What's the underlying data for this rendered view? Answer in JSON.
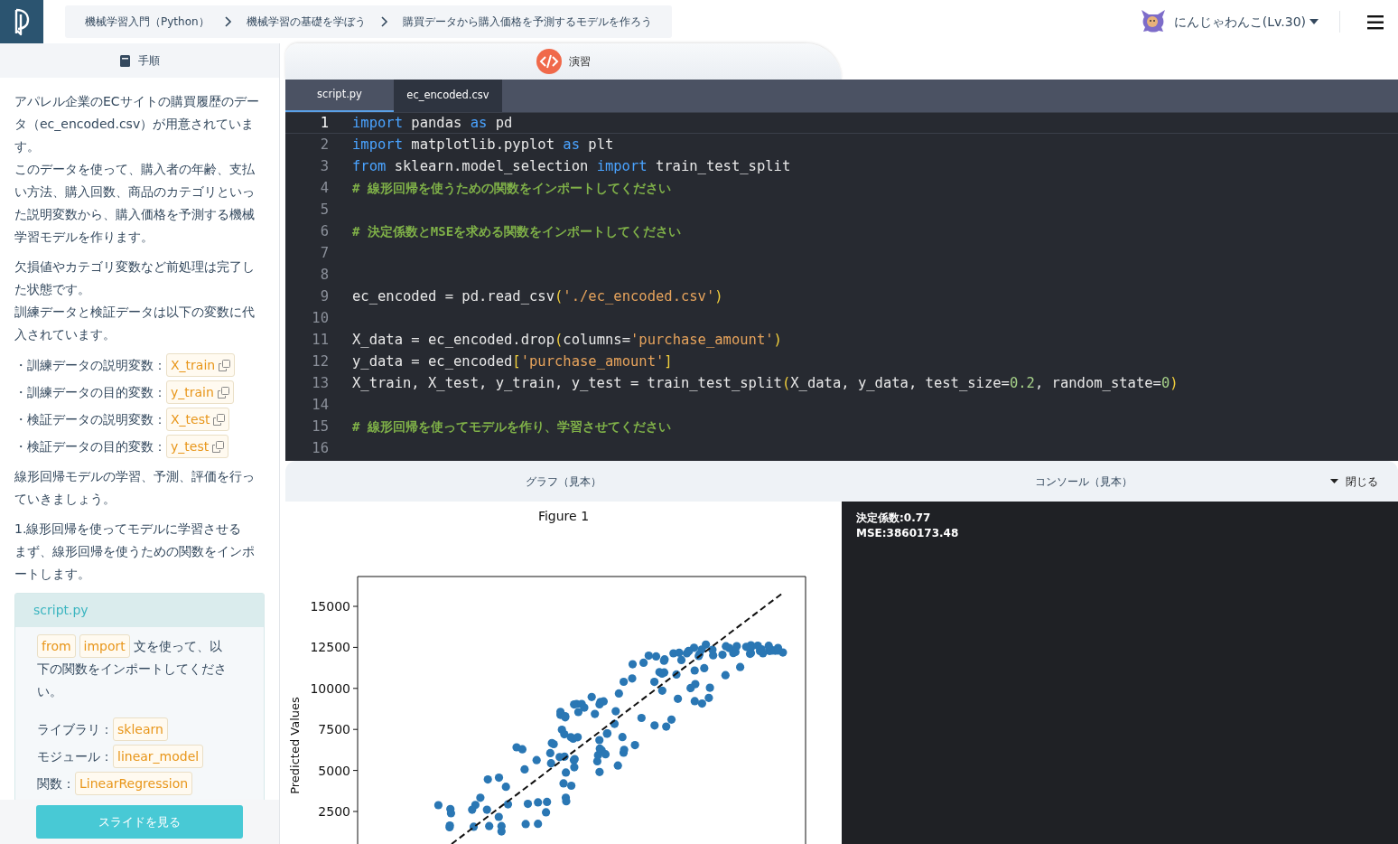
{
  "header": {
    "breadcrumb": [
      "機械学習入門（Python）",
      "機械学習の基礎を学ぼう",
      "購買データから購入価格を予測するモデルを作ろう"
    ],
    "user": "にんじゃわんこ(Lv.30)"
  },
  "steps_panel": {
    "tab": "手順",
    "paragraphs_before": [
      [
        "アパレル企業のECサイトの購買履歴のデータ（ec_encoded.csv）が用意されています。",
        "このデータを使って、購入者の年齢、支払い方法、購入回数、商品のカテゴリといった説明変数から、購入価格を予測する機械学習モデルを作ります。"
      ],
      [
        "欠損値やカテゴリ変数など前処理は完了した状態です。",
        "訓練データと検証データは以下の変数に代入されています。"
      ]
    ],
    "variables": [
      {
        "label": "・訓練データの説明変数：",
        "value": "X_train"
      },
      {
        "label": "・訓練データの目的変数：",
        "value": "y_train"
      },
      {
        "label": "・検証データの説明変数：",
        "value": "X_test"
      },
      {
        "label": "・検証データの目的変数：",
        "value": "y_test"
      }
    ],
    "paragraphs_after": [
      [
        "線形回帰モデルの学習、予測、評価を行っていきましょう。"
      ],
      [
        "1.線形回帰を使ってモデルに学習させる",
        "まず、線形回帰を使うための関数をインポートします。"
      ]
    ],
    "hint": {
      "title": "script.py",
      "chips": [
        "from",
        "import"
      ],
      "text": "文を使って、以下の関数をインポートしてください。",
      "items": [
        {
          "label": "ライブラリ：",
          "value": "sklearn"
        },
        {
          "label": "モジュール：",
          "value": "linear_model"
        },
        {
          "label": "関数：",
          "value": "LinearRegression"
        }
      ]
    },
    "button": "スライドを見る"
  },
  "exercise_tab": "演習",
  "files": [
    {
      "name": "script.py",
      "selected": true
    },
    {
      "name": "ec_encoded.csv",
      "selected": false
    }
  ],
  "code_lines": [
    {
      "number": "1",
      "current": true,
      "tokens": [
        {
          "kind": "keyword",
          "text": "import"
        },
        {
          "kind": "plain",
          "text": " pandas "
        },
        {
          "kind": "keyword",
          "text": "as"
        },
        {
          "kind": "plain",
          "text": " pd"
        }
      ]
    },
    {
      "number": "2",
      "current": false,
      "tokens": [
        {
          "kind": "keyword",
          "text": "import"
        },
        {
          "kind": "plain",
          "text": " matplotlib.pyplot "
        },
        {
          "kind": "keyword",
          "text": "as"
        },
        {
          "kind": "plain",
          "text": " plt"
        }
      ]
    },
    {
      "number": "3",
      "current": false,
      "tokens": [
        {
          "kind": "keyword",
          "text": "from"
        },
        {
          "kind": "plain",
          "text": " sklearn.model_selection "
        },
        {
          "kind": "keyword",
          "text": "import"
        },
        {
          "kind": "plain",
          "text": " train_test_split"
        }
      ]
    },
    {
      "number": "4",
      "current": false,
      "tokens": [
        {
          "kind": "comment",
          "text": "# 線形回帰を使うための関数をインポートしてください"
        }
      ]
    },
    {
      "number": "5",
      "current": false
    },
    {
      "number": "6",
      "current": false,
      "tokens": [
        {
          "kind": "comment",
          "text": "# 決定係数とMSEを求める関数をインポートしてください"
        }
      ]
    },
    {
      "number": "7",
      "current": false
    },
    {
      "number": "8",
      "current": false
    },
    {
      "number": "9",
      "current": false,
      "tokens": [
        {
          "kind": "plain",
          "text": "ec_encoded = pd.read_csv"
        },
        {
          "kind": "bracket",
          "text": "("
        },
        {
          "kind": "string",
          "text": "'./ec_encoded.csv'"
        },
        {
          "kind": "bracket",
          "text": ")"
        }
      ]
    },
    {
      "number": "10",
      "current": false
    },
    {
      "number": "11",
      "current": false,
      "tokens": [
        {
          "kind": "plain",
          "text": "X_data = ec_encoded.drop"
        },
        {
          "kind": "bracket",
          "text": "("
        },
        {
          "kind": "plain",
          "text": "columns="
        },
        {
          "kind": "string",
          "text": "'purchase_amount'"
        },
        {
          "kind": "bracket",
          "text": ")"
        }
      ]
    },
    {
      "number": "12",
      "current": false,
      "tokens": [
        {
          "kind": "plain",
          "text": "y_data = ec_encoded"
        },
        {
          "kind": "bracket",
          "text": "["
        },
        {
          "kind": "string",
          "text": "'purchase_amount'"
        },
        {
          "kind": "bracket",
          "text": "]"
        }
      ]
    },
    {
      "number": "13",
      "current": false,
      "tokens": [
        {
          "kind": "plain",
          "text": "X_train, X_test, y_train, y_test = train_test_split"
        },
        {
          "kind": "bracket",
          "text": "("
        },
        {
          "kind": "plain",
          "text": "X_data, y_data, test_size="
        },
        {
          "kind": "number",
          "text": "0.2"
        },
        {
          "kind": "plain",
          "text": ", random_state="
        },
        {
          "kind": "number",
          "text": "0"
        },
        {
          "kind": "bracket",
          "text": ")"
        }
      ]
    },
    {
      "number": "14",
      "current": false
    },
    {
      "number": "15",
      "current": false,
      "tokens": [
        {
          "kind": "comment",
          "text": "# 線形回帰を使ってモデルを作り、学習させてください"
        }
      ]
    },
    {
      "number": "16",
      "current": false
    }
  ],
  "output_panel": {
    "graph_tab": "グラフ（見本）",
    "console_tab": "コンソール（見本）",
    "close": "閉じる",
    "figure": {
      "title": "Figure 1",
      "ylabel": "Predicted Values",
      "y_tick_labels": [
        "15000",
        "12500",
        "10000",
        "7500",
        "5000",
        "2500"
      ]
    },
    "console_lines": [
      "決定係数:0.77",
      "MSE:3860173.48"
    ]
  }
}
